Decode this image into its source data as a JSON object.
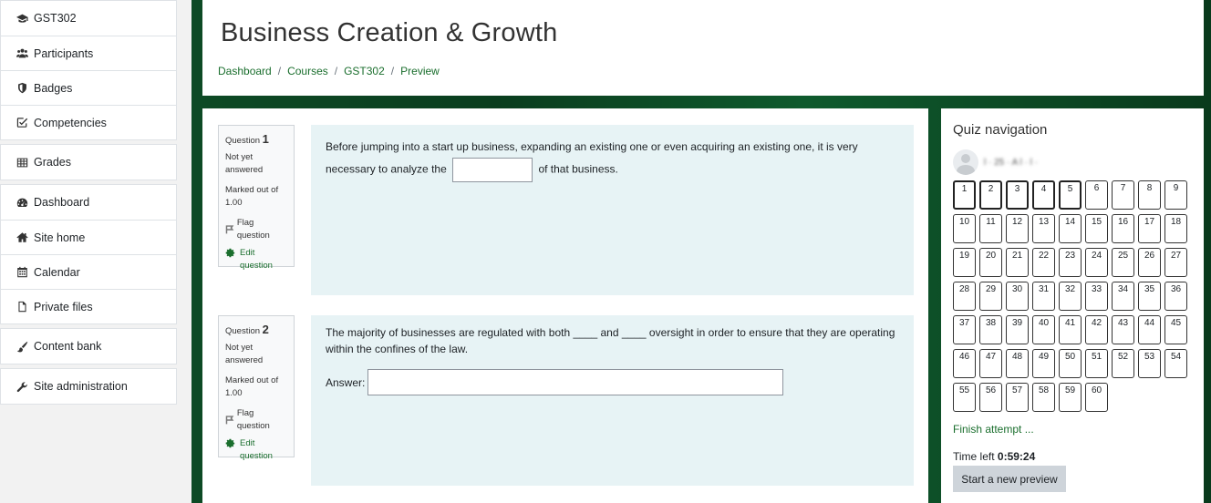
{
  "sidebar": {
    "groups": [
      [
        {
          "label": "GST302",
          "icon": "graduation-cap-icon"
        },
        {
          "label": "Participants",
          "icon": "users-icon"
        },
        {
          "label": "Badges",
          "icon": "shield-icon"
        },
        {
          "label": "Competencies",
          "icon": "checkbox-icon"
        }
      ],
      [
        {
          "label": "Grades",
          "icon": "table-icon"
        }
      ],
      [
        {
          "label": "Dashboard",
          "icon": "dashboard-icon"
        },
        {
          "label": "Site home",
          "icon": "home-icon"
        },
        {
          "label": "Calendar",
          "icon": "calendar-icon"
        },
        {
          "label": "Private files",
          "icon": "file-icon"
        }
      ],
      [
        {
          "label": "Content bank",
          "icon": "paintbrush-icon"
        }
      ],
      [
        {
          "label": "Site administration",
          "icon": "wrench-icon"
        }
      ]
    ]
  },
  "header": {
    "title": "Business Creation & Growth",
    "breadcrumb": [
      "Dashboard",
      "Courses",
      "GST302",
      "Preview"
    ]
  },
  "questions": [
    {
      "label": "Question",
      "number": "1",
      "state": "Not yet answered",
      "grade": "Marked out of 1.00",
      "flag": "Flag question",
      "edit": "Edit question",
      "text_before": "Before jumping into a start up business, expanding an existing one or even acquiring an existing one, it is very necessary to analyze the",
      "text_after": "of that business."
    },
    {
      "label": "Question",
      "number": "2",
      "state": "Not yet answered",
      "grade": "Marked out of 1.00",
      "flag": "Flag question",
      "edit": "Edit question",
      "text": "The majority of businesses are regulated with both ____ and ____ oversight in order to ensure that they are operating within the confines of the law.",
      "answer_label": "Answer:"
    }
  ],
  "quiz_nav": {
    "title": "Quiz navigation",
    "user_name": "l  ·  25  ·  A  l  ·  l  ·",
    "question_count": 60,
    "current_questions": [
      1,
      2,
      3,
      4,
      5
    ],
    "finish_label": "Finish attempt ...",
    "time_label": "Time left",
    "time_value": "0:59:24",
    "new_preview_label": "Start a new preview"
  }
}
